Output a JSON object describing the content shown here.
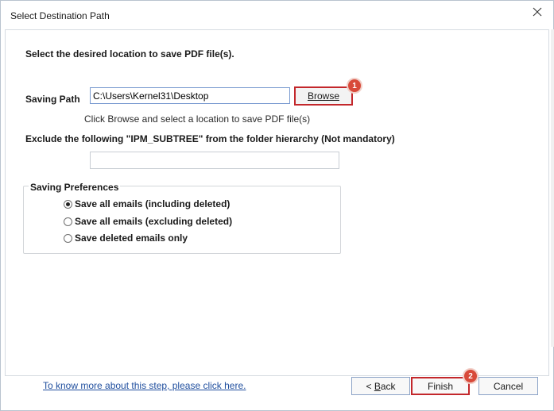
{
  "window": {
    "title": "Select Destination Path"
  },
  "main": {
    "heading": "Select the desired location to save PDF file(s).",
    "saving_path_label": "Saving Path",
    "saving_path_value": "C:\\Users\\Kernel31\\Desktop",
    "browse_label": "Browse",
    "hint": "Click Browse and select a location to save PDF file(s)",
    "exclude_label": "Exclude the following \"IPM_SUBTREE\" from the folder hierarchy (Not mandatory)",
    "exclude_value": ""
  },
  "preferences": {
    "legend": "Saving Preferences",
    "options": [
      {
        "label": "Save all emails (including deleted)",
        "checked": true
      },
      {
        "label": "Save all emails (excluding deleted)",
        "checked": false
      },
      {
        "label": "Save deleted emails only",
        "checked": false
      }
    ]
  },
  "footer": {
    "help_link": "To know more about this step, please click here.",
    "back_label_prefix": "< ",
    "back_label_accel": "B",
    "back_label_rest": "ack",
    "finish_label": "Finish",
    "cancel_label": "Cancel"
  },
  "badges": {
    "browse": "1",
    "finish": "2"
  },
  "icons": {
    "close": "close-icon"
  },
  "colors": {
    "highlight": "#c3272b",
    "badge": "#d84a3a",
    "link": "#1f4e9e"
  }
}
